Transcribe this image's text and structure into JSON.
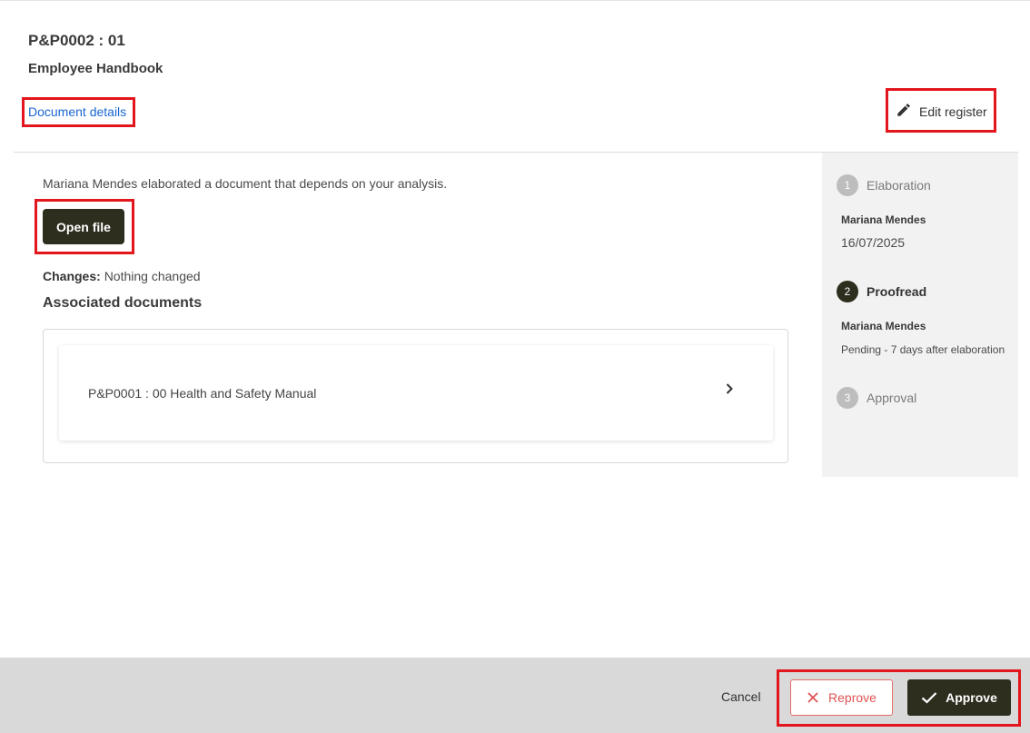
{
  "header": {
    "doc_code": "P&P0002 : 01",
    "doc_title": "Employee Handbook",
    "details_link": "Document details",
    "edit_register": "Edit register"
  },
  "main": {
    "intro": "Mariana Mendes elaborated a document that depends on your analysis.",
    "open_file": "Open file",
    "changes_label": "Changes:",
    "changes_value": "Nothing changed",
    "associated_heading": "Associated documents",
    "associated_documents": [
      {
        "label": "P&P0001 : 00 Health and Safety Manual"
      }
    ]
  },
  "workflow": {
    "steps": [
      {
        "number": "1",
        "label": "Elaboration",
        "person": "Mariana Mendes",
        "date": "16/07/2025",
        "state": "done"
      },
      {
        "number": "2",
        "label": "Proofread",
        "person": "Mariana Mendes",
        "status": "Pending - 7 days after elaboration",
        "state": "current"
      },
      {
        "number": "3",
        "label": "Approval",
        "state": "upcoming"
      }
    ]
  },
  "footer": {
    "cancel": "Cancel",
    "reprove": "Reprove",
    "approve": "Approve"
  },
  "colors": {
    "primary_dark": "#2e2e1f",
    "link_blue": "#1a66d2",
    "reprove_red": "#e05252",
    "highlight_red": "#e2161c"
  },
  "icons": {
    "edit": "pencil-icon",
    "chevron": "chevron-right-icon",
    "reprove": "close-icon",
    "approve": "check-icon"
  }
}
